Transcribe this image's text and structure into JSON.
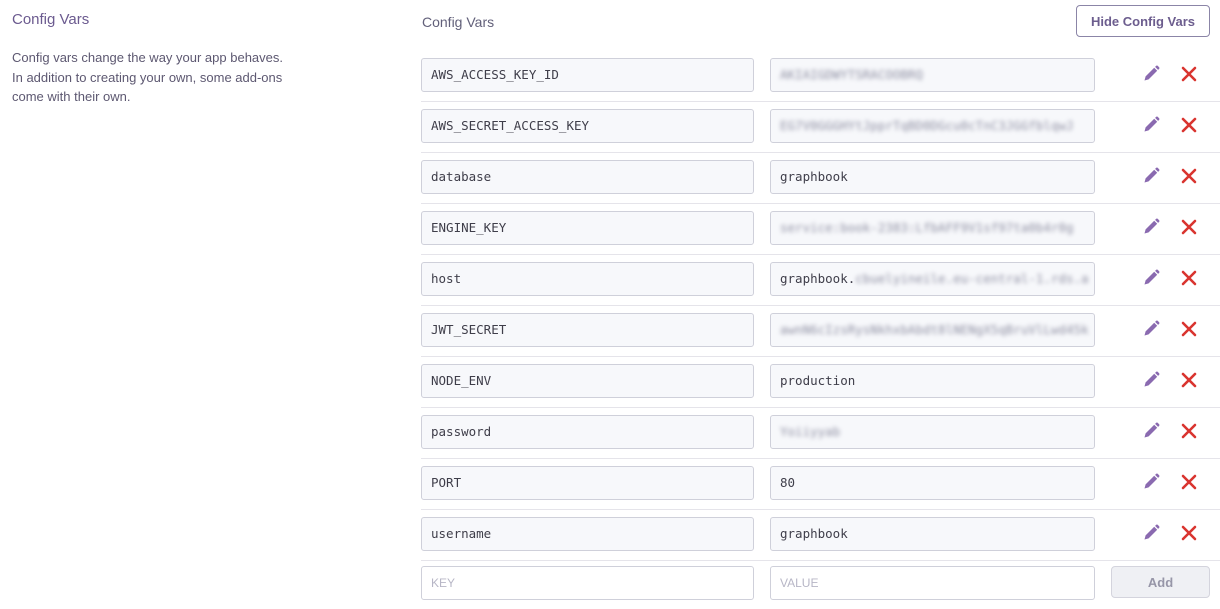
{
  "sidebar": {
    "title": "Config Vars",
    "description": "Config vars change the way your app behaves. In addition to creating your own, some add-ons come with their own."
  },
  "main": {
    "title": "Config Vars",
    "hide_button_label": "Hide Config Vars",
    "config_vars": [
      {
        "key": "AWS_ACCESS_KEY_ID",
        "value_visible": "",
        "value_hidden": "AKIAIGDWYTSRACOOBRQ"
      },
      {
        "key": "AWS_SECRET_ACCESS_KEY",
        "value_visible": "",
        "value_hidden": "EG7V0GGGHYtJpprTqBD0DGcu0cTnC3JGGfblqwJ"
      },
      {
        "key": "database",
        "value_visible": "graphbook",
        "value_hidden": ""
      },
      {
        "key": "ENGINE_KEY",
        "value_visible": "",
        "value_hidden": "service:book-2383:LfbAFF9V1sf97ta0b4r0g"
      },
      {
        "key": "host",
        "value_visible": "graphbook.",
        "value_hidden": "cbuelyineile.eu-central-1.rds.a"
      },
      {
        "key": "JWT_SECRET",
        "value_visible": "",
        "value_hidden": "awnN6cIzsRysNkhxbAbdt8lNENgX5qBruVlLwd45k"
      },
      {
        "key": "NODE_ENV",
        "value_visible": "production",
        "value_hidden": ""
      },
      {
        "key": "password",
        "value_visible": "",
        "value_hidden": "Yoiiyyab"
      },
      {
        "key": "PORT",
        "value_visible": "80",
        "value_hidden": ""
      },
      {
        "key": "username",
        "value_visible": "graphbook",
        "value_hidden": ""
      }
    ],
    "new_var": {
      "key_placeholder": "KEY",
      "value_placeholder": "VALUE",
      "add_button_label": "Add"
    }
  },
  "colors": {
    "accent": "#6c5d8e",
    "edit_icon": "#8a6ab0",
    "delete_icon": "#d9342f"
  },
  "icons": {
    "edit": "pencil-icon",
    "delete": "close-icon"
  }
}
